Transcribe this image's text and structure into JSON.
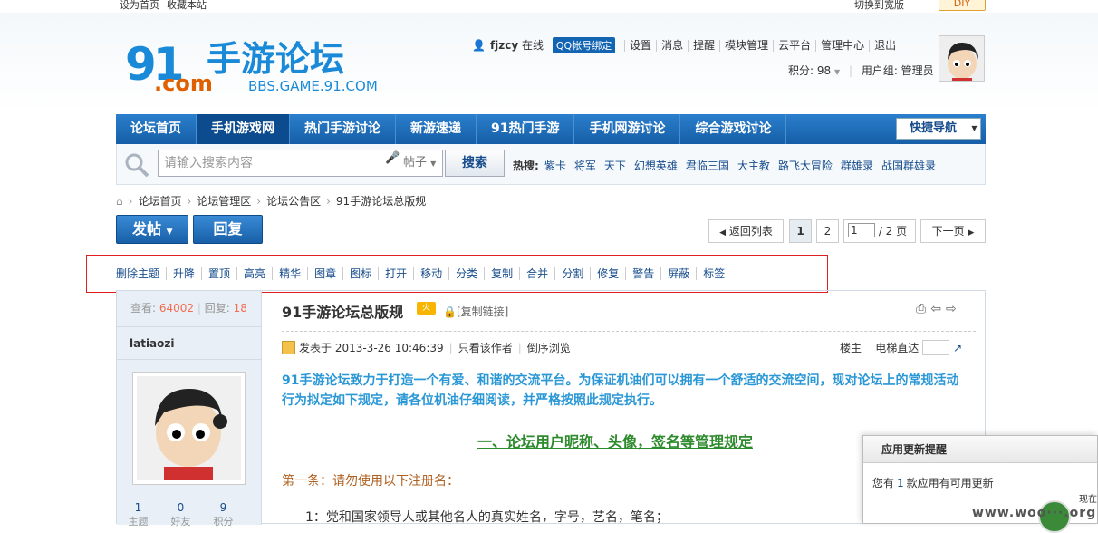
{
  "top": {
    "set_home": "设为首页",
    "bookmark": "收藏本站",
    "switch_wide": "切换到宽版",
    "diy": "DIY"
  },
  "logo": {
    "n91": "91",
    "com": ".com",
    "cn": "手游论坛",
    "url": "BBS.GAME.91.COM"
  },
  "user": {
    "name": "fjzcy",
    "online": "在线",
    "qq": "QQ帐号绑定",
    "links": [
      "设置",
      "消息",
      "提醒",
      "模块管理",
      "云平台",
      "管理中心",
      "退出"
    ],
    "points": "积分: 98",
    "group": "用户组: 管理员"
  },
  "nav": {
    "items": [
      "论坛首页",
      "手机游戏网",
      "热门手游讨论",
      "新游速递",
      "91热门手游",
      "手机网游讨论",
      "综合游戏讨论"
    ],
    "quick": "快捷导航"
  },
  "search": {
    "placeholder": "请输入搜索内容",
    "type": "帖子",
    "button": "搜索",
    "hot_label": "热搜:",
    "hot": [
      "紫卡",
      "将军",
      "天下",
      "幻想英雄",
      "君临三国",
      "大主教",
      "路飞大冒险",
      "群雄录",
      "战国群雄录"
    ]
  },
  "crumbs": [
    "论坛首页",
    "论坛管理区",
    "论坛公告区",
    "91手游论坛总版规"
  ],
  "actions": {
    "post": "发帖",
    "reply": "回复",
    "back": "返回列表",
    "page1": "1",
    "page2": "2",
    "page_input": "1",
    "page_total": "/ 2 页",
    "next": "下一页"
  },
  "mod": [
    "删除主题",
    "升降",
    "置顶",
    "高亮",
    "精华",
    "图章",
    "图标",
    "打开",
    "移动",
    "分类",
    "复制",
    "合并",
    "分割",
    "修复",
    "警告",
    "屏蔽",
    "标签"
  ],
  "post": {
    "views_label": "查看:",
    "views": "64002",
    "replies_label": "回复:",
    "replies": "18",
    "author": "latiaozi",
    "title": "91手游论坛总版规",
    "copy": "[复制链接]",
    "meta_posted": "发表于 2013-3-26 10:46:39",
    "meta_only": "只看该作者",
    "meta_order": "倒序浏览",
    "floor": "楼主",
    "jump": "电梯直达",
    "intro": "91手游论坛致力于打造一个有爱、和谐的交流平台。为保证机油们可以拥有一个舒适的交流空间，现对论坛上的常规活动行为拟定如下规定，请各位机油仔细阅读，并严格按照此规定执行。",
    "section": "一、论坛用户昵称、头像，签名等管理规定",
    "art1": "第一条：请勿使用以下注册名：",
    "art2": "1：党和国家领导人或其他名人的真实姓名，字号，艺名，笔名；",
    "side_stats": [
      {
        "v": "1",
        "l": "主题"
      },
      {
        "v": "0",
        "l": "好友"
      },
      {
        "v": "9",
        "l": "积分"
      }
    ]
  },
  "popup": {
    "title": "应用更新提醒",
    "pre": "您有",
    "count": "1",
    "post": "款应用有可用更新"
  },
  "watermark": "www.woo···.org",
  "corner": "现在"
}
